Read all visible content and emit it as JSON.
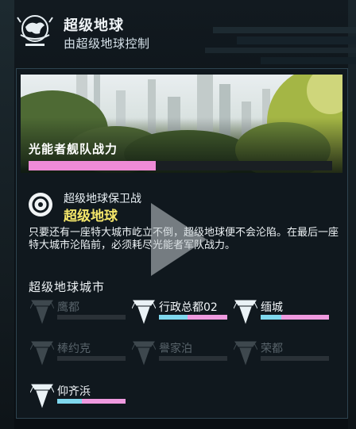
{
  "header": {
    "title": "超级地球",
    "subtitle": "由超级地球控制",
    "logo_icon": "super-earth-globe-icon"
  },
  "banner": {
    "label": "光能者舰队战力",
    "fleet_strength": 0.42,
    "fleet_color": "#ef8bd7"
  },
  "defense": {
    "label": "超级地球保卫战",
    "name": "超级地球",
    "icon": "target-ring-icon",
    "description": "只要还有一座特大城市屹立不倒，超级地球便不会沦陷。在最后一座特大城市沦陷前，必须耗尽光能者军队战力。"
  },
  "cities_section": {
    "title": "超级地球城市",
    "cities": [
      {
        "name": "鹰都",
        "status": "fallen",
        "cyan": 0,
        "pink": 0
      },
      {
        "name": "行政总都02",
        "status": "active",
        "cyan": 0.42,
        "pink": 0.58
      },
      {
        "name": "缅城",
        "status": "active",
        "cyan": 0.3,
        "pink": 0.7
      },
      {
        "name": "棒约克",
        "status": "fallen",
        "cyan": 0,
        "pink": 0
      },
      {
        "name": "譽家泊",
        "status": "fallen",
        "cyan": 0,
        "pink": 0
      },
      {
        "name": "荣都",
        "status": "fallen",
        "cyan": 0,
        "pink": 0
      },
      {
        "name": "仰齐浜",
        "status": "active",
        "cyan": 0.36,
        "pink": 0.64
      }
    ]
  },
  "colors": {
    "cyan": "#7fd8ee",
    "pink": "#ef9adf",
    "gold": "#f5e76a"
  }
}
